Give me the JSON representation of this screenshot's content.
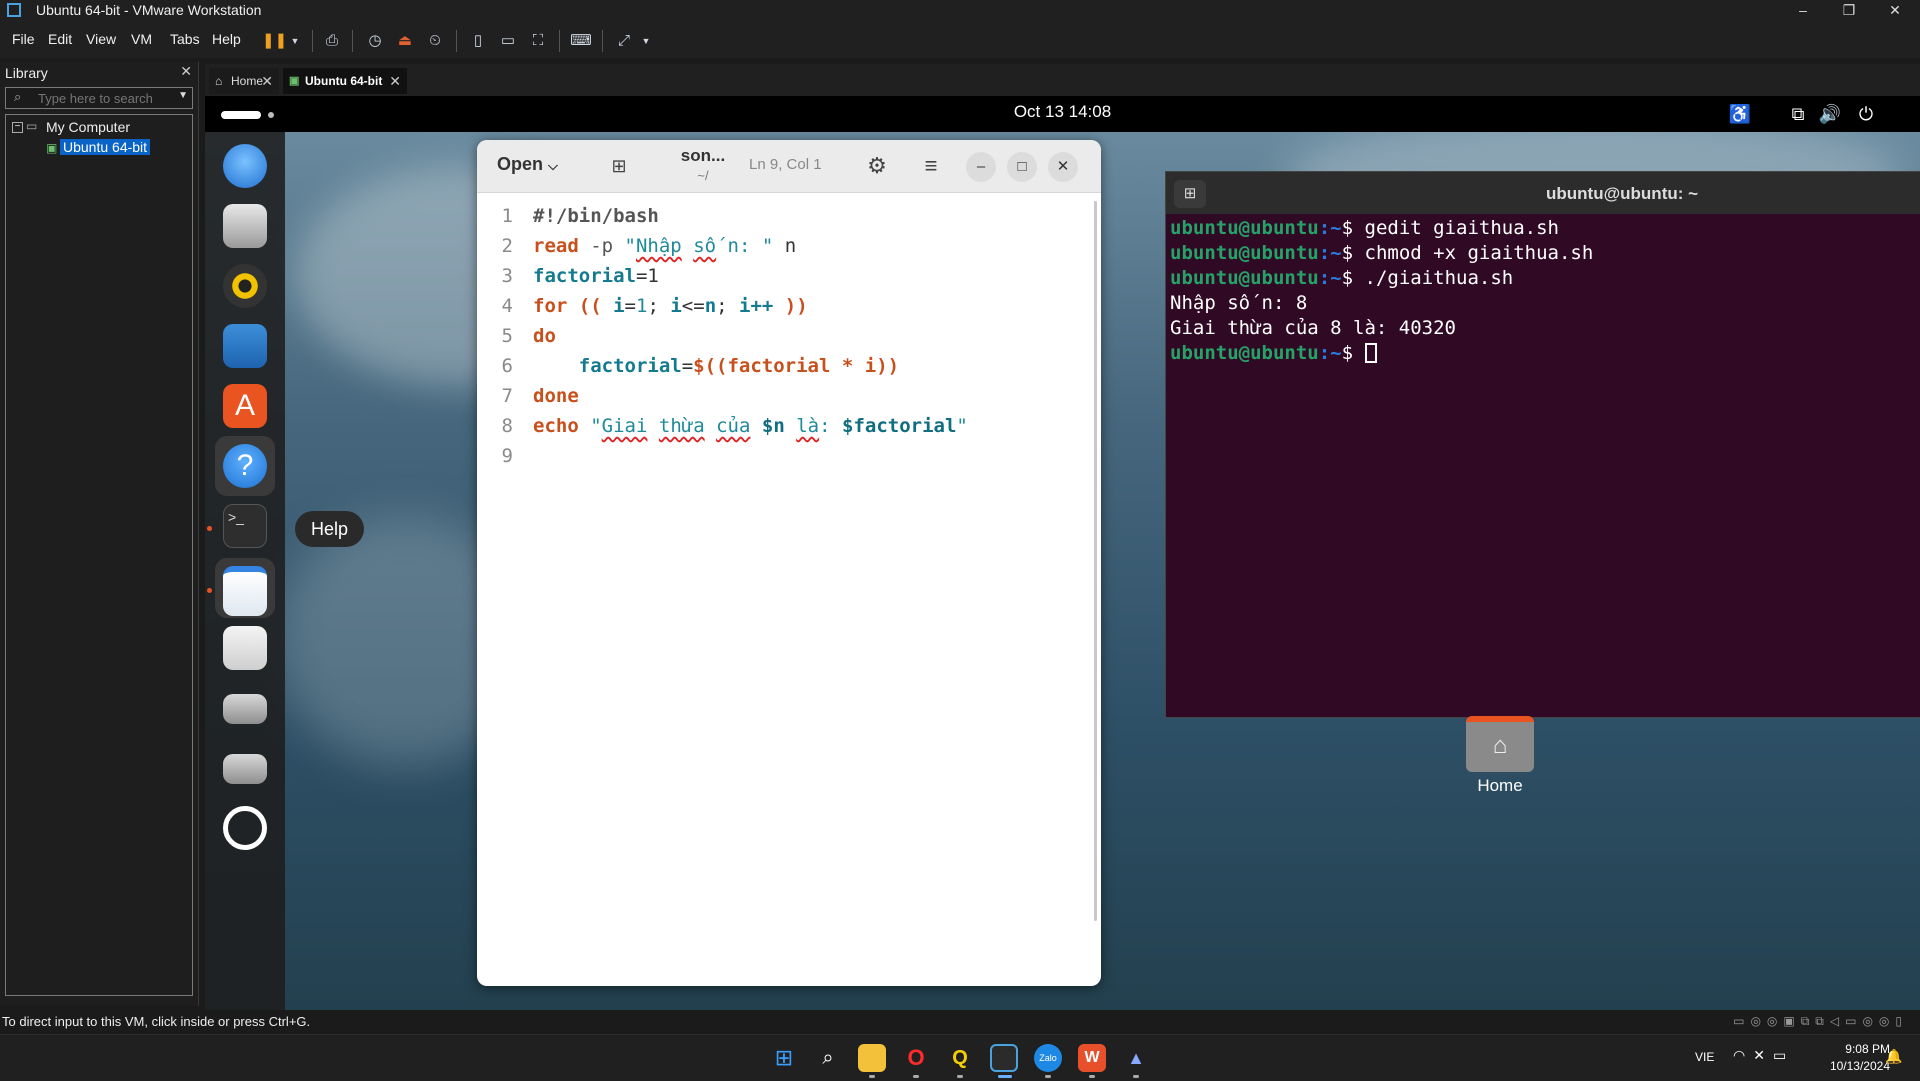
{
  "window": {
    "title": "Ubuntu 64-bit - VMware Workstation"
  },
  "menu": {
    "items": [
      "File",
      "Edit",
      "View",
      "VM",
      "Tabs",
      "Help"
    ]
  },
  "library": {
    "title": "Library",
    "search_placeholder": "Type here to search",
    "tree": {
      "root": "My Computer",
      "child": "Ubuntu 64-bit"
    }
  },
  "tabs": [
    {
      "label": "Home"
    },
    {
      "label": "Ubuntu 64-bit"
    }
  ],
  "ubuntu": {
    "clock": "Oct 13  14:08",
    "tooltip": "Help",
    "desktop_icon_label": "Home"
  },
  "gedit": {
    "open_label": "Open",
    "filename": "son...",
    "path": "~/",
    "cursor_pos": "Ln 9, Col 1",
    "line_numbers": [
      "1",
      "2",
      "3",
      "4",
      "5",
      "6",
      "7",
      "8",
      "9"
    ],
    "code": {
      "l1": "#!/bin/bash",
      "l2_kw": "read",
      "l2_opt": " -p ",
      "l2_q1": "\"",
      "l2_w1": "Nhập",
      "l2_s1": " ",
      "l2_w2": "số",
      "l2_s2": " n: \"",
      "l2_var": " n",
      "l3_var": "factorial",
      "l3_rest": "=1",
      "l4_kw": "for",
      "l4_rest": " (( ",
      "l4_i1": "i",
      "l4_eq": "=",
      "l4_one": "1",
      "l4_semi1": "; ",
      "l4_i2": "i",
      "l4_le": "<=",
      "l4_n": "n",
      "l4_semi2": "; ",
      "l4_i3": "i++",
      "l4_end": " ))",
      "l5_kw": "do",
      "l6_indent": "    ",
      "l6_var": "factorial",
      "l6_eq": "=",
      "l6_expr": "$((factorial * i))",
      "l7_kw": "done",
      "l8_kw": "echo",
      "l8_q1": " \"",
      "l8_w1": "Giai",
      "l8_s1": " ",
      "l8_w2": "thừa",
      "l8_s2": " ",
      "l8_w3": "của",
      "l8_s3": " ",
      "l8_n": "$n",
      "l8_s4": " ",
      "l8_w4": "là",
      "l8_colon": ": ",
      "l8_fac": "$factorial",
      "l8_q2": "\""
    }
  },
  "terminal": {
    "title": "ubuntu@ubuntu: ~",
    "prompt_user": "ubuntu@ubuntu",
    "prompt_path": ":~",
    "prompt_sign": "$ ",
    "cmd1": "gedit giaithua.sh",
    "cmd2": "chmod +x giaithua.sh",
    "cmd3": "./giaithua.sh",
    "out1": "Nhập số n: 8",
    "out2": "Giai thừa của 8 là: 40320"
  },
  "status": {
    "message": "To direct input to this VM, click inside or press Ctrl+G."
  },
  "taskbar": {
    "lang": "VIE",
    "time": "9:08 PM",
    "date": "10/13/2024"
  },
  "colors": {
    "ubuntu_orange": "#e95420",
    "terminal_bg": "#300a24",
    "selection_blue": "#0a64c8"
  }
}
